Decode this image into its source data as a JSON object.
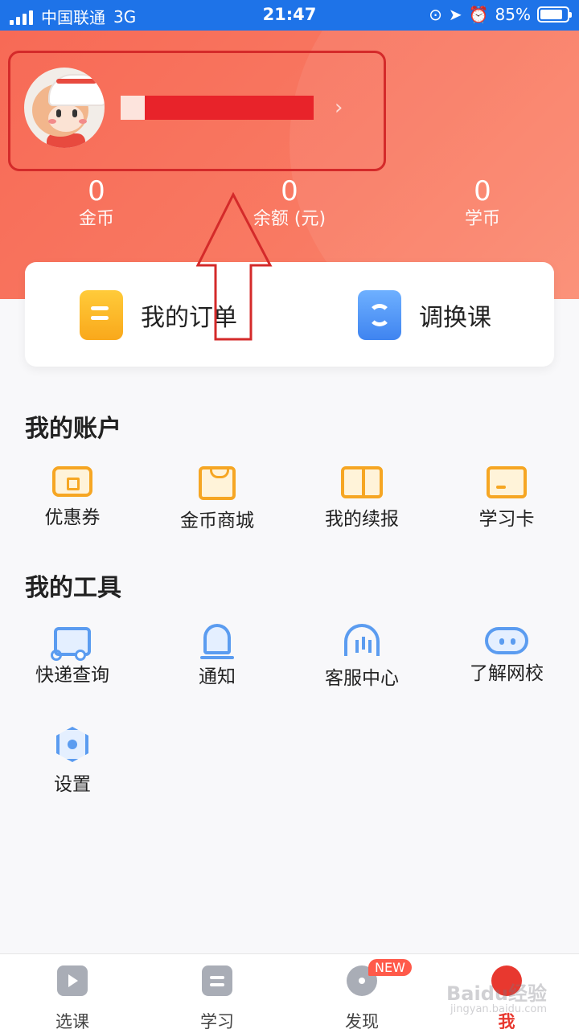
{
  "status_bar": {
    "carrier": "中国联通",
    "network": "3G",
    "time": "21:47",
    "battery": "85%"
  },
  "profile": {
    "chevron": "›"
  },
  "stats": [
    {
      "value": "0",
      "label": "金币"
    },
    {
      "value": "0",
      "label": "余额 (元)"
    },
    {
      "value": "0",
      "label": "学币"
    }
  ],
  "quick_actions": [
    {
      "label": "我的订单",
      "icon": "order-icon"
    },
    {
      "label": "调换课",
      "icon": "swap-icon"
    }
  ],
  "account": {
    "title": "我的账户",
    "items": [
      {
        "label": "优惠券",
        "icon": "coupon-icon"
      },
      {
        "label": "金币商城",
        "icon": "shopping-bag-icon"
      },
      {
        "label": "我的续报",
        "icon": "book-icon"
      },
      {
        "label": "学习卡",
        "icon": "card-icon"
      }
    ]
  },
  "tools": {
    "title": "我的工具",
    "items": [
      {
        "label": "快递查询",
        "icon": "truck-icon"
      },
      {
        "label": "通知",
        "icon": "bell-icon"
      },
      {
        "label": "客服中心",
        "icon": "headset-icon"
      },
      {
        "label": "了解网校",
        "icon": "cloud-icon"
      },
      {
        "label": "设置",
        "icon": "gear-icon"
      }
    ]
  },
  "tabbar": {
    "items": [
      {
        "label": "选课",
        "icon": "play-icon"
      },
      {
        "label": "学习",
        "icon": "study-icon"
      },
      {
        "label": "发现",
        "icon": "discover-icon",
        "badge": "NEW"
      },
      {
        "label": "我",
        "icon": "me-icon",
        "active": true
      }
    ]
  },
  "watermark": {
    "text": "Baidu经验",
    "url_text": "jingyan.baidu.com"
  },
  "colors": {
    "status_bar": "#1e73e8",
    "header": "#f76a56",
    "accent": "#e8382f",
    "account_icons": "#f6a623",
    "tool_icons": "#5b9cf0"
  }
}
